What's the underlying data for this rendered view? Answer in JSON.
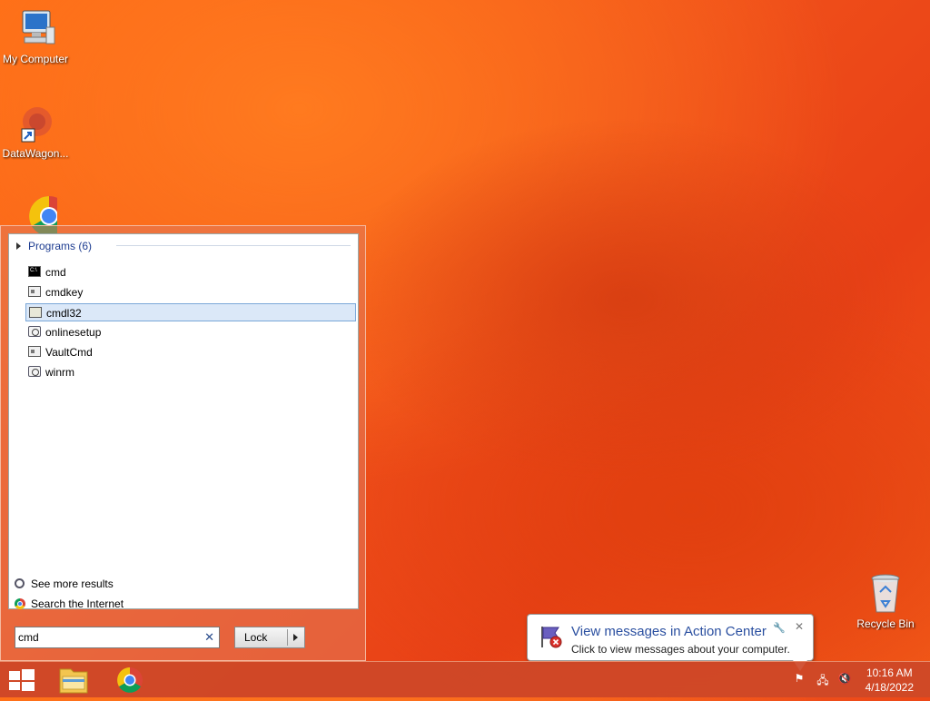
{
  "desktop": {
    "icons": [
      {
        "label": "My Computer"
      },
      {
        "label": "DataWagon..."
      },
      {
        "label": ""
      },
      {
        "label": "Recycle Bin"
      }
    ]
  },
  "start_menu": {
    "group_header": "Programs (6)",
    "results": [
      {
        "label": "cmd",
        "icon": "cmd-icon"
      },
      {
        "label": "cmdkey",
        "icon": "window-icon"
      },
      {
        "label": "cmdl32",
        "icon": "certificate-icon",
        "selected": true
      },
      {
        "label": "onlinesetup",
        "icon": "gear-icon"
      },
      {
        "label": "VaultCmd",
        "icon": "window-icon"
      },
      {
        "label": "winrm",
        "icon": "gear-icon"
      }
    ],
    "see_more": "See more results",
    "search_internet": "Search the Internet",
    "search_value": "cmd",
    "clear_glyph": "✕",
    "lock_label": "Lock"
  },
  "notification": {
    "title": "View messages in Action Center",
    "message": "Click to view messages about your computer.",
    "close_glyph": "✕"
  },
  "taskbar": {
    "time": "10:16 AM",
    "date": "4/18/2022"
  },
  "colors": {
    "accent": "#1e3d91",
    "selection": "#dbe8f8",
    "taskbar": "#cd4828"
  }
}
